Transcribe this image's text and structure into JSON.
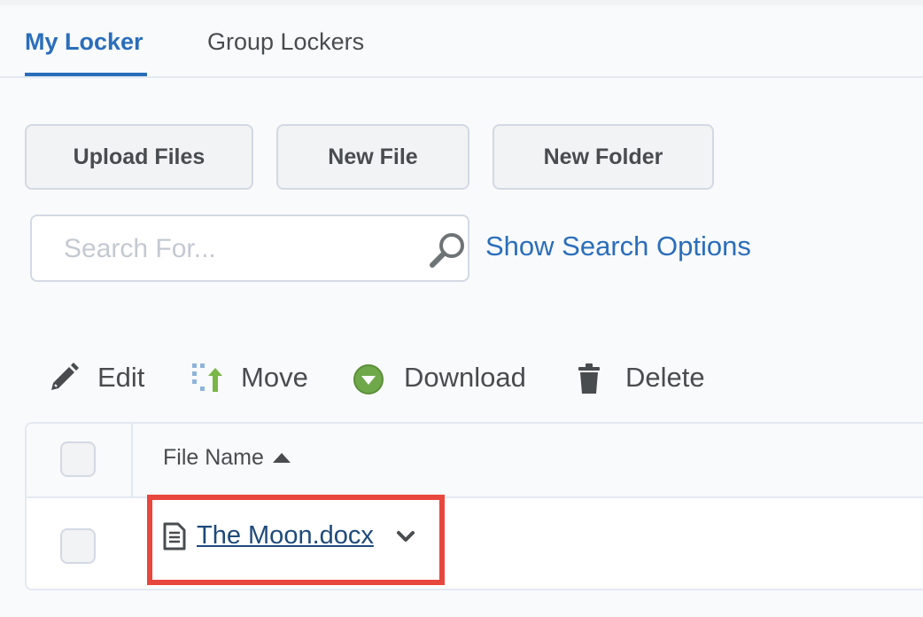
{
  "tabs": [
    {
      "label": "My Locker",
      "active": true
    },
    {
      "label": "Group Lockers",
      "active": false
    }
  ],
  "buttons": {
    "upload": "Upload Files",
    "new_file": "New File",
    "new_folder": "New Folder"
  },
  "search": {
    "placeholder": "Search For...",
    "value": "",
    "show_options": "Show Search Options"
  },
  "actions": {
    "edit": "Edit",
    "move": "Move",
    "download": "Download",
    "delete": "Delete"
  },
  "table": {
    "column_header": "File Name",
    "rows": [
      {
        "name": "The Moon.docx",
        "icon": "document-icon"
      }
    ]
  },
  "colors": {
    "accent": "#2a6ebb",
    "link": "#1e4a7b",
    "highlight": "#e8473d",
    "download_green": "#6fa84a"
  }
}
